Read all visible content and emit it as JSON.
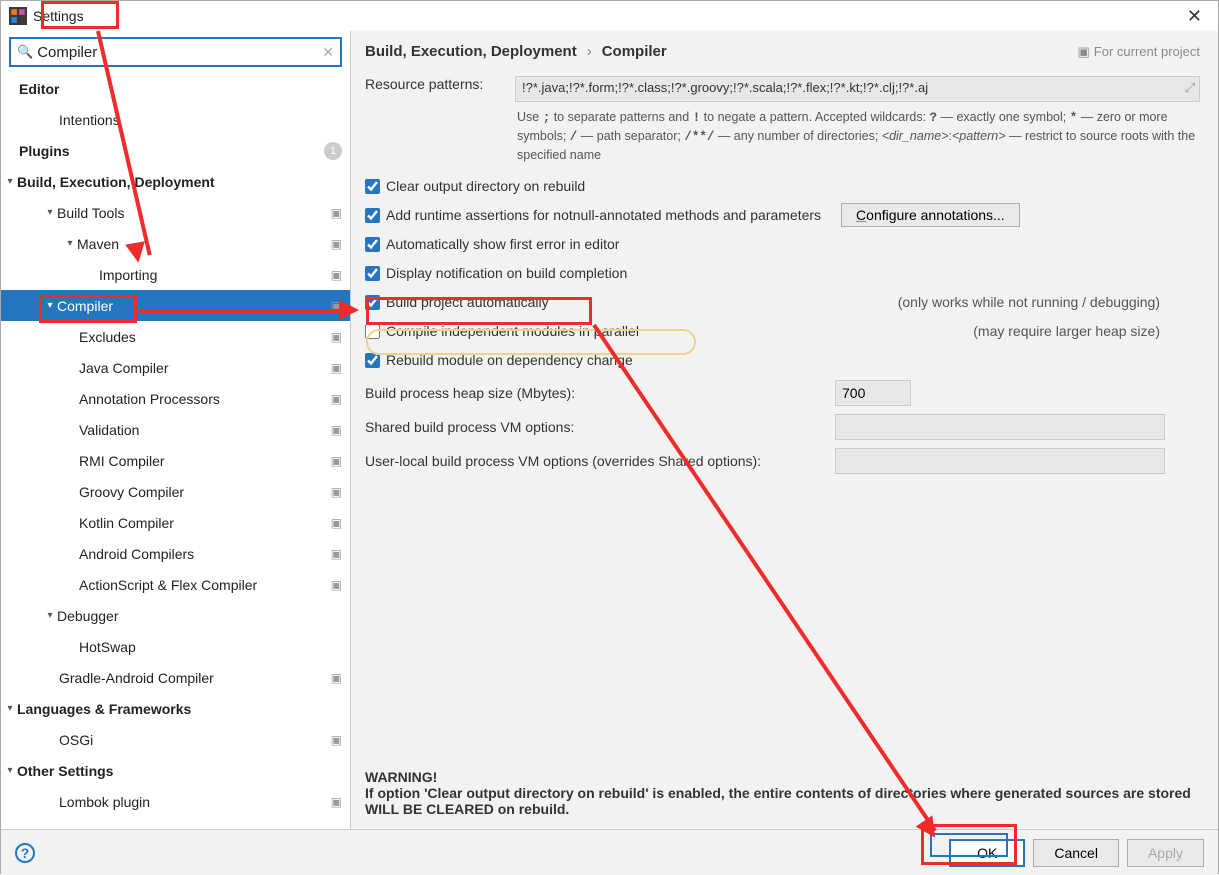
{
  "window": {
    "title": "Settings"
  },
  "search": {
    "value": "Compiler"
  },
  "sidebar": {
    "items": [
      {
        "label": "Editor",
        "depth": 0,
        "bold": true
      },
      {
        "label": "Intentions",
        "depth": 2
      },
      {
        "label": "Plugins",
        "depth": 0,
        "bold": true,
        "badge": "1"
      },
      {
        "label": "Build, Execution, Deployment",
        "depth": 0,
        "bold": true,
        "chev": "▾"
      },
      {
        "label": "Build Tools",
        "depth": 2,
        "project": true,
        "chev": "▾"
      },
      {
        "label": "Maven",
        "depth": 3,
        "project": true,
        "chev": "▾"
      },
      {
        "label": "Importing",
        "depth": 4,
        "project": true
      },
      {
        "label": "Compiler",
        "depth": 2,
        "project": true,
        "chev": "▾",
        "selected": true
      },
      {
        "label": "Excludes",
        "depth": 3,
        "project": true
      },
      {
        "label": "Java Compiler",
        "depth": 3,
        "project": true
      },
      {
        "label": "Annotation Processors",
        "depth": 3,
        "project": true
      },
      {
        "label": "Validation",
        "depth": 3,
        "project": true
      },
      {
        "label": "RMI Compiler",
        "depth": 3,
        "project": true
      },
      {
        "label": "Groovy Compiler",
        "depth": 3,
        "project": true
      },
      {
        "label": "Kotlin Compiler",
        "depth": 3,
        "project": true
      },
      {
        "label": "Android Compilers",
        "depth": 3,
        "project": true
      },
      {
        "label": "ActionScript & Flex Compiler",
        "depth": 3,
        "project": true
      },
      {
        "label": "Debugger",
        "depth": 2,
        "chev": "▾"
      },
      {
        "label": "HotSwap",
        "depth": 3
      },
      {
        "label": "Gradle-Android Compiler",
        "depth": 2,
        "project": true
      },
      {
        "label": "Languages & Frameworks",
        "depth": 0,
        "bold": true,
        "chev": "▾"
      },
      {
        "label": "OSGi",
        "depth": 2,
        "project": true
      },
      {
        "label": "Other Settings",
        "depth": 0,
        "bold": true,
        "chev": "▾"
      },
      {
        "label": "Lombok plugin",
        "depth": 2,
        "project": true
      }
    ]
  },
  "breadcrumb": {
    "part1": "Build, Execution, Deployment",
    "part2": "Compiler",
    "hint": "For current project"
  },
  "form": {
    "resource_label": "Resource patterns:",
    "resource_value": "!?*.java;!?*.form;!?*.class;!?*.groovy;!?*.scala;!?*.flex;!?*.kt;!?*.clj;!?*.aj",
    "hint_plain": "Use ; to separate patterns and ! to negate a pattern. Accepted wildcards: ? — exactly one symbol; * — zero or more symbols; / — path separator; /**/ — any number of directories; <dir_name>:<pattern> — restrict to source roots with the specified name",
    "cb_clear": "Clear output directory on rebuild",
    "cb_assert": "Add runtime assertions for notnull-annotated methods and parameters",
    "configure_btn": "Configure annotations...",
    "cb_first_error": "Automatically show first error in editor",
    "cb_notify": "Display notification on build completion",
    "cb_auto": "Build project automatically",
    "cb_auto_aside": "(only works while not running / debugging)",
    "cb_parallel": "Compile independent modules in parallel",
    "cb_parallel_aside": "(may require larger heap size)",
    "cb_rebuild_dep": "Rebuild module on dependency change",
    "heap_label": "Build process heap size (Mbytes):",
    "heap_value": "700",
    "shared_vm_label": "Shared build process VM options:",
    "user_vm_label": "User-local build process VM options (overrides Shared options):"
  },
  "warning": {
    "head": "WARNING!",
    "body": "If option 'Clear output directory on rebuild' is enabled, the entire contents of directories where generated sources are stored WILL BE CLEARED on rebuild."
  },
  "footer": {
    "ok": "OK",
    "cancel": "Cancel",
    "apply": "Apply"
  }
}
